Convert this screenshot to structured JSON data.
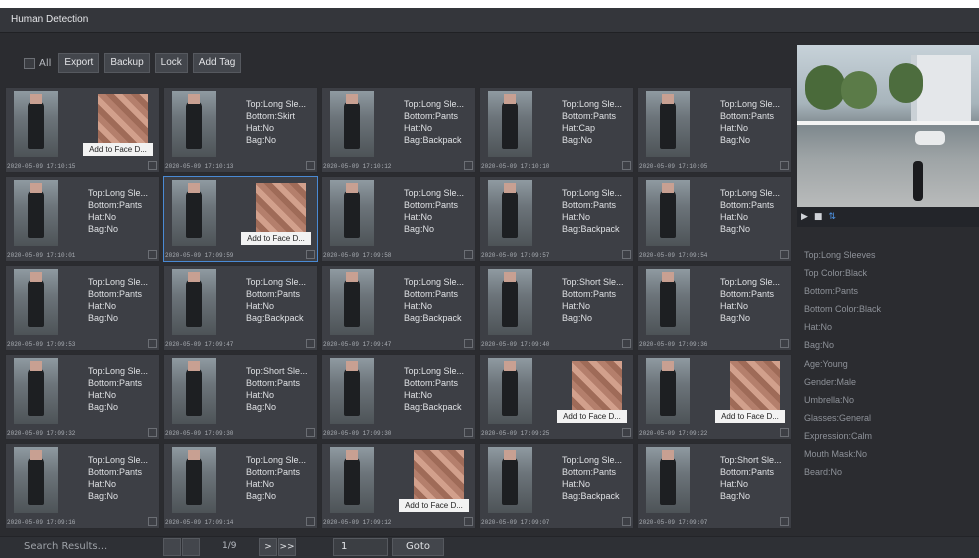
{
  "window": {
    "title": "Human Detection"
  },
  "toolbar": {
    "all_label": "All",
    "export_label": "Export",
    "backup_label": "Backup",
    "lock_label": "Lock",
    "add_tag_label": "Add Tag"
  },
  "results": [
    {
      "timestamp": "2020-05-09 17:10:15",
      "face_button_label": "Add to Face D..."
    },
    {
      "timestamp": "2020-05-09 17:10:13",
      "attributes": [
        "Top:Long Sle...",
        "Bottom:Skirt",
        "Hat:No",
        "Bag:No"
      ]
    },
    {
      "timestamp": "2020-05-09 17:10:12",
      "attributes": [
        "Top:Long Sle...",
        "Bottom:Pants",
        "Hat:No",
        "Bag:Backpack"
      ]
    },
    {
      "timestamp": "2020-05-09 17:10:10",
      "attributes": [
        "Top:Long Sle...",
        "Bottom:Pants",
        "Hat:Cap",
        "Bag:No"
      ]
    },
    {
      "timestamp": "2020-05-09 17:10:05",
      "attributes": [
        "Top:Long Sle...",
        "Bottom:Pants",
        "Hat:No",
        "Bag:No"
      ]
    },
    {
      "timestamp": "2020-05-09 17:10:01",
      "attributes": [
        "Top:Long Sle...",
        "Bottom:Pants",
        "Hat:No",
        "Bag:No"
      ]
    },
    {
      "timestamp": "2020-05-09 17:09:59",
      "face_button_label": "Add to Face D...",
      "selected": true
    },
    {
      "timestamp": "2020-05-09 17:09:58",
      "attributes": [
        "Top:Long Sle...",
        "Bottom:Pants",
        "Hat:No",
        "Bag:No"
      ]
    },
    {
      "timestamp": "2020-05-09 17:09:57",
      "attributes": [
        "Top:Long Sle...",
        "Bottom:Pants",
        "Hat:No",
        "Bag:Backpack"
      ]
    },
    {
      "timestamp": "2020-05-09 17:09:54",
      "attributes": [
        "Top:Long Sle...",
        "Bottom:Pants",
        "Hat:No",
        "Bag:No"
      ]
    },
    {
      "timestamp": "2020-05-09 17:09:53",
      "attributes": [
        "Top:Long Sle...",
        "Bottom:Pants",
        "Hat:No",
        "Bag:No"
      ]
    },
    {
      "timestamp": "2020-05-09 17:09:47",
      "attributes": [
        "Top:Long Sle...",
        "Bottom:Pants",
        "Hat:No",
        "Bag:Backpack"
      ]
    },
    {
      "timestamp": "2020-05-09 17:09:47",
      "attributes": [
        "Top:Long Sle...",
        "Bottom:Pants",
        "Hat:No",
        "Bag:Backpack"
      ]
    },
    {
      "timestamp": "2020-05-09 17:09:40",
      "attributes": [
        "Top:Short Sle...",
        "Bottom:Pants",
        "Hat:No",
        "Bag:No"
      ]
    },
    {
      "timestamp": "2020-05-09 17:09:36",
      "attributes": [
        "Top:Long Sle...",
        "Bottom:Pants",
        "Hat:No",
        "Bag:No"
      ]
    },
    {
      "timestamp": "2020-05-09 17:09:32",
      "attributes": [
        "Top:Long Sle...",
        "Bottom:Pants",
        "Hat:No",
        "Bag:No"
      ]
    },
    {
      "timestamp": "2020-05-09 17:09:30",
      "attributes": [
        "Top:Short Sle...",
        "Bottom:Pants",
        "Hat:No",
        "Bag:No"
      ]
    },
    {
      "timestamp": "2020-05-09 17:09:30",
      "attributes": [
        "Top:Long Sle...",
        "Bottom:Pants",
        "Hat:No",
        "Bag:Backpack"
      ]
    },
    {
      "timestamp": "2020-05-09 17:09:25",
      "face_button_label": "Add to Face D..."
    },
    {
      "timestamp": "2020-05-09 17:09:22",
      "face_button_label": "Add to Face D..."
    },
    {
      "timestamp": "2020-05-09 17:09:16",
      "attributes": [
        "Top:Long Sle...",
        "Bottom:Pants",
        "Hat:No",
        "Bag:No"
      ]
    },
    {
      "timestamp": "2020-05-09 17:09:14",
      "attributes": [
        "Top:Long Sle...",
        "Bottom:Pants",
        "Hat:No",
        "Bag:No"
      ]
    },
    {
      "timestamp": "2020-05-09 17:09:12",
      "face_button_label": "Add to Face D..."
    },
    {
      "timestamp": "2020-05-09 17:09:07",
      "attributes": [
        "Top:Long Sle...",
        "Bottom:Pants",
        "Hat:No",
        "Bag:Backpack"
      ]
    },
    {
      "timestamp": "2020-05-09 17:09:07",
      "attributes": [
        "Top:Short Sle...",
        "Bottom:Pants",
        "Hat:No",
        "Bag:No"
      ]
    }
  ],
  "details": [
    "Top:Long Sleeves",
    "Top Color:Black",
    "Bottom:Pants",
    "Bottom Color:Black",
    "Hat:No",
    "Bag:No",
    "Age:Young",
    "Gender:Male",
    "Umbrella:No",
    "Glasses:General",
    "Expression:Calm",
    "Mouth Mask:No",
    "Beard:No"
  ],
  "playback": {
    "play_icon": "play-icon",
    "stop_icon": "stop-icon",
    "download_icon": "download-icon"
  },
  "pagination": {
    "search_results_label": "Search Results...",
    "page_label": "1/9",
    "next_label": ">",
    "last_label": ">>",
    "goto_value": "1",
    "goto_label": "Goto"
  }
}
